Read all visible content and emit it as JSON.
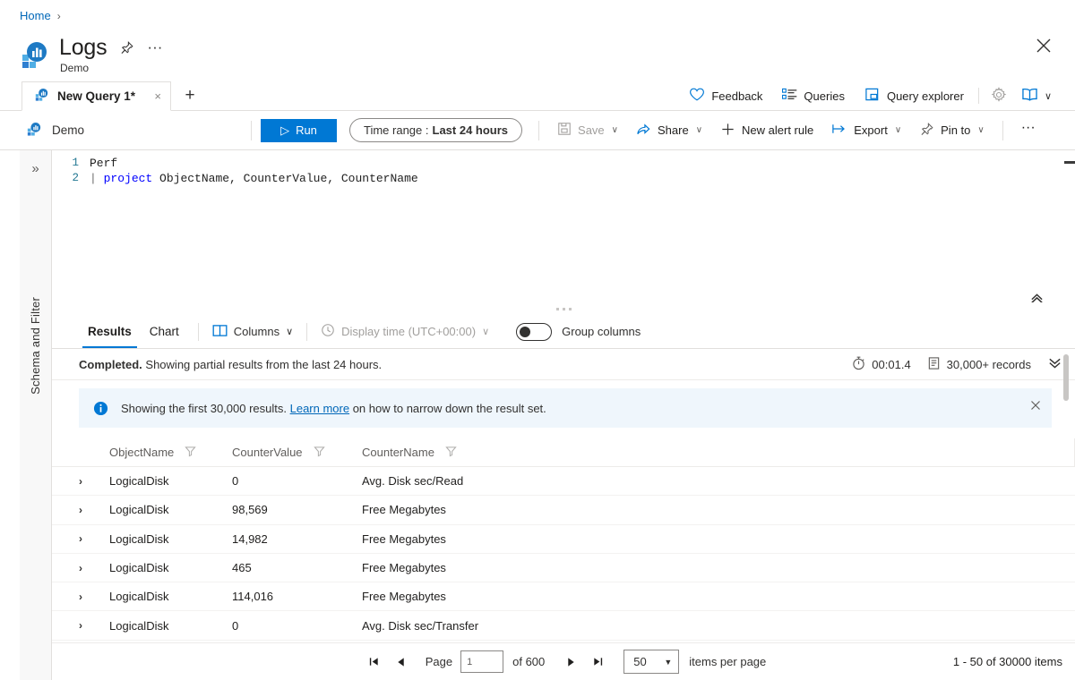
{
  "breadcrumb": {
    "home": "Home",
    "separator": "›"
  },
  "header": {
    "title": "Logs",
    "subtitle": "Demo",
    "pin_icon": "pin-icon",
    "more_icon": "ellipsis-icon",
    "close_icon": "close-icon"
  },
  "tabs": {
    "items": [
      {
        "label": "New Query 1*",
        "icon": "query-icon",
        "close": "×"
      }
    ],
    "new_tab": "+",
    "actions": [
      {
        "label": "Feedback",
        "icon": "heart-icon"
      },
      {
        "label": "Queries",
        "icon": "list-icon"
      },
      {
        "label": "Query explorer",
        "icon": "explorer-icon"
      }
    ],
    "settings_icon": "gear-icon",
    "book_icon": "book-icon",
    "book_chevron": "∨"
  },
  "commandbar": {
    "workspace": "Demo",
    "workspace_icon": "workspace-icon",
    "run_label": "Run",
    "run_icon": "▷",
    "time_range_label": "Time range :",
    "time_range_value": "Last 24 hours",
    "buttons": [
      {
        "label": "Save",
        "icon": "save-icon",
        "chevron": "∨",
        "disabled": true
      },
      {
        "label": "Share",
        "icon": "share-icon",
        "chevron": "∨",
        "disabled": false
      },
      {
        "label": "New alert rule",
        "icon": "plus-icon",
        "chevron": "",
        "disabled": false
      },
      {
        "label": "Export",
        "icon": "export-icon",
        "chevron": "∨",
        "disabled": false
      },
      {
        "label": "Pin to",
        "icon": "pin-icon",
        "chevron": "∨",
        "disabled": false
      }
    ],
    "more_label": "···"
  },
  "leftrail": {
    "expand_icon": "»",
    "label": "Schema and Filter"
  },
  "editor": {
    "lines": [
      {
        "num": "1",
        "kw": "",
        "pipe": "",
        "text": "Perf"
      },
      {
        "num": "2",
        "kw": "project",
        "pipe": "|",
        "text": " ObjectName, CounterValue, CounterName"
      }
    ],
    "line1_num": "1",
    "line2_num": "2",
    "line1_text": "Perf",
    "line2_pipe": "|",
    "line2_kw": "project",
    "line2_args": " ObjectName, CounterValue, CounterName",
    "collapse_icon": "chevron-double-up-icon"
  },
  "results": {
    "tabs": [
      {
        "label": "Results",
        "active": true
      },
      {
        "label": "Chart",
        "active": false
      }
    ],
    "columns_button": "Columns",
    "columns_chevron": "∨",
    "display_time": "Display time (UTC+00:00)",
    "display_time_chevron": "∨",
    "group_columns": "Group columns",
    "status_bold": "Completed.",
    "status_text": " Showing partial results from the last 24 hours.",
    "duration": "00:01.4",
    "record_count": "30,000+ records",
    "expand_chevron": "⌄",
    "banner": {
      "text_before": "Showing the first 30,000 results. ",
      "link": "Learn more",
      "text_after": " on how to narrow down the result set.",
      "close": "×"
    },
    "table": {
      "headers": [
        "ObjectName",
        "CounterValue",
        "CounterName"
      ],
      "rows": [
        {
          "expand": "›",
          "ObjectName": "LogicalDisk",
          "CounterValue": "0",
          "CounterName": "Avg. Disk sec/Read"
        },
        {
          "expand": "›",
          "ObjectName": "LogicalDisk",
          "CounterValue": "98,569",
          "CounterName": "Free Megabytes"
        },
        {
          "expand": "›",
          "ObjectName": "LogicalDisk",
          "CounterValue": "14,982",
          "CounterName": "Free Megabytes"
        },
        {
          "expand": "›",
          "ObjectName": "LogicalDisk",
          "CounterValue": "465",
          "CounterName": "Free Megabytes"
        },
        {
          "expand": "›",
          "ObjectName": "LogicalDisk",
          "CounterValue": "114,016",
          "CounterName": "Free Megabytes"
        },
        {
          "expand": "›",
          "ObjectName": "LogicalDisk",
          "CounterValue": "0",
          "CounterName": "Avg. Disk sec/Transfer"
        }
      ]
    },
    "pager": {
      "first": "⧏",
      "prev": "◀",
      "page_label": "Page",
      "page_value": "1",
      "of_label": "of 600",
      "next": "▶",
      "last": "⧐",
      "page_size": "50",
      "page_size_caret": "▼",
      "items_per_page": "items per page",
      "range_text": "1 - 50 of 30000 items"
    }
  },
  "colors": {
    "accent": "#0078d4",
    "link": "#0067b8",
    "banner_bg": "#eff6fc",
    "border": "#e1dfdd"
  }
}
